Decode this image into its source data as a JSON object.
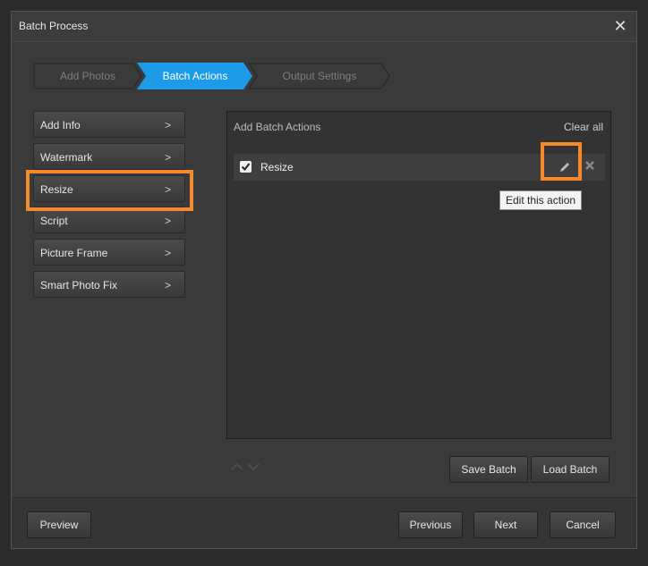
{
  "window": {
    "title": "Batch Process",
    "close_glyph": "✕"
  },
  "steps": [
    {
      "label": "Add Photos",
      "state": "done"
    },
    {
      "label": "Batch Actions",
      "state": "active"
    },
    {
      "label": "Output Settings",
      "state": "pending"
    }
  ],
  "actions": [
    {
      "label": "Add Info",
      "chevron": ">"
    },
    {
      "label": "Watermark",
      "chevron": ">"
    },
    {
      "label": "Resize",
      "chevron": ">"
    },
    {
      "label": "Script",
      "chevron": ">"
    },
    {
      "label": "Picture Frame",
      "chevron": ">"
    },
    {
      "label": "Smart Photo Fix",
      "chevron": ">"
    }
  ],
  "panel": {
    "title": "Add Batch Actions",
    "clear_all": "Clear all",
    "items": [
      {
        "label": "Resize",
        "checked": true
      }
    ],
    "tooltip": "Edit this action"
  },
  "buttons": {
    "save_batch": "Save Batch",
    "load_batch": "Load Batch",
    "preview": "Preview",
    "previous": "Previous",
    "next": "Next",
    "cancel": "Cancel"
  },
  "icons": {
    "edit": "pencil-icon",
    "delete": "x-icon",
    "move_up": "chevron-up-icon",
    "move_down": "chevron-down-icon"
  },
  "colors": {
    "accent": "#1e9be8",
    "highlight": "#f38a2b"
  }
}
